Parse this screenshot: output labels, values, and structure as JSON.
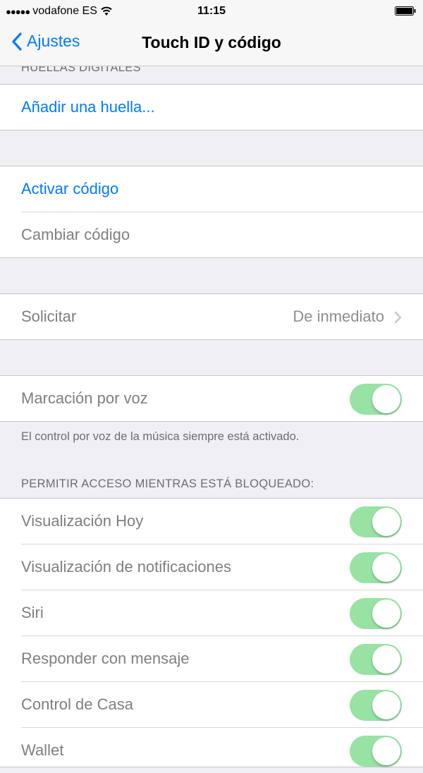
{
  "status_bar": {
    "signal_dots": "●●●●●",
    "carrier": "vodafone ES",
    "wifi_icon": "wifi-icon",
    "time": "11:15",
    "battery_icon": "battery-icon"
  },
  "nav": {
    "back_label": "Ajustes",
    "title": "Touch ID y código"
  },
  "sections": {
    "fingerprints_header": "HUELLAS DIGITALES",
    "add_fingerprint": "Añadir una huella...",
    "activate_code": "Activar código",
    "change_code": "Cambiar código",
    "require_label": "Solicitar",
    "require_value": "De inmediato",
    "voice_dial_label": "Marcación por voz",
    "voice_dial_on": true,
    "voice_footer": "El control por voz de la música siempre está activado.",
    "locked_access_header": "PERMITIR ACCESO MIENTRAS ESTÁ BLOQUEADO:",
    "locked_items": [
      {
        "label": "Visualización Hoy",
        "on": true
      },
      {
        "label": "Visualización de notificaciones",
        "on": true
      },
      {
        "label": "Siri",
        "on": true
      },
      {
        "label": "Responder con mensaje",
        "on": true
      },
      {
        "label": "Control de Casa",
        "on": true
      },
      {
        "label": "Wallet",
        "on": true
      }
    ]
  },
  "colors": {
    "accent": "#007aff",
    "toggle_on": "#98e2a4",
    "background": "#efeff4"
  }
}
